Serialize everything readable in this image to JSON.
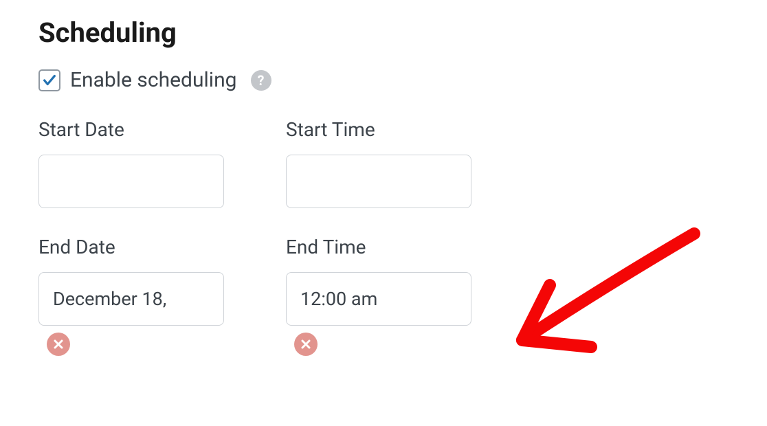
{
  "section": {
    "title": "Scheduling"
  },
  "enable": {
    "label": "Enable scheduling",
    "checked": true
  },
  "fields": {
    "start_date": {
      "label": "Start Date",
      "value": ""
    },
    "start_time": {
      "label": "Start Time",
      "value": ""
    },
    "end_date": {
      "label": "End Date",
      "value": "December 18,"
    },
    "end_time": {
      "label": "End Time",
      "value": "12:00 am"
    }
  },
  "colors": {
    "check": "#2271b1",
    "clear_bg": "#e2948e",
    "arrow": "#f40606"
  }
}
